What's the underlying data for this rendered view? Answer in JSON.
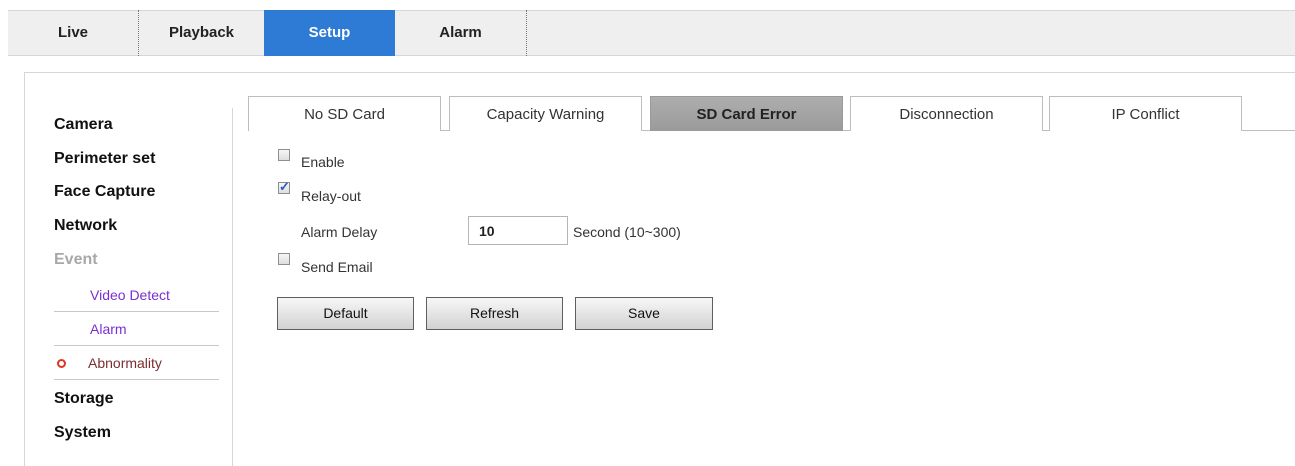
{
  "top_nav": {
    "tabs": [
      {
        "label": "Live"
      },
      {
        "label": "Playback"
      },
      {
        "label": "Setup",
        "active": true
      },
      {
        "label": "Alarm"
      }
    ],
    "active_color": "#2e7bd6"
  },
  "sidebar": {
    "items": [
      {
        "label": "Camera"
      },
      {
        "label": "Perimeter set"
      },
      {
        "label": "Face Capture"
      },
      {
        "label": "Network"
      },
      {
        "label": "Event",
        "expanded": true,
        "children": [
          {
            "label": "Video Detect"
          },
          {
            "label": "Alarm"
          },
          {
            "label": "Abnormality",
            "selected": true,
            "icon": "ring-icon"
          }
        ]
      },
      {
        "label": "Storage"
      },
      {
        "label": "System"
      }
    ]
  },
  "sub_tabs": [
    {
      "label": "No SD Card"
    },
    {
      "label": "Capacity Warning"
    },
    {
      "label": "SD Card Error",
      "active": true
    },
    {
      "label": "Disconnection"
    },
    {
      "label": "IP Conflict"
    }
  ],
  "form": {
    "enable": {
      "label": "Enable",
      "checked": false
    },
    "relay_out": {
      "label": "Relay-out",
      "checked": true
    },
    "alarm_delay": {
      "label": "Alarm Delay",
      "value": "10",
      "unit": "Second (10~300)"
    },
    "send_email": {
      "label": "Send Email",
      "checked": false
    }
  },
  "buttons": {
    "default": "Default",
    "refresh": "Refresh",
    "save": "Save"
  }
}
